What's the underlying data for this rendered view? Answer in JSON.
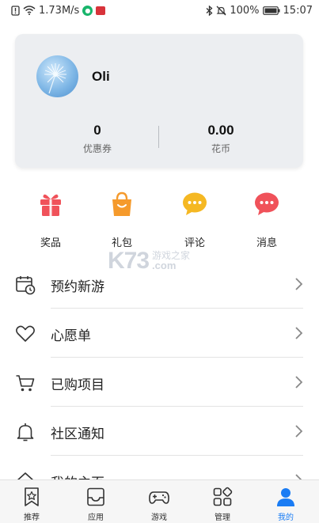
{
  "status_bar": {
    "speed": "1.73M/s",
    "battery": "100%",
    "time": "15:07"
  },
  "profile": {
    "username": "Oli",
    "stats": [
      {
        "value": "0",
        "label": "优惠券"
      },
      {
        "value": "0.00",
        "label": "花币"
      }
    ]
  },
  "quick_actions": [
    {
      "label": "奖品",
      "icon": "gift-icon",
      "color": "#f0525a"
    },
    {
      "label": "礼包",
      "icon": "bag-icon",
      "color": "#f59a2c"
    },
    {
      "label": "评论",
      "icon": "comment-icon",
      "color": "#f5b823"
    },
    {
      "label": "消息",
      "icon": "message-icon",
      "color": "#f0525a"
    }
  ],
  "watermark": {
    "logo": "K73",
    "line1": "游戏之家",
    "line2": ".com"
  },
  "menu": [
    {
      "label": "预约新游",
      "icon": "calendar-clock-icon"
    },
    {
      "label": "心愿单",
      "icon": "heart-icon"
    },
    {
      "label": "已购项目",
      "icon": "cart-icon"
    },
    {
      "label": "社区通知",
      "icon": "bell-icon"
    },
    {
      "label": "我的主页",
      "icon": "home-icon"
    }
  ],
  "bottom_nav": [
    {
      "label": "推荐",
      "icon": "star-bookmark-icon",
      "active": false
    },
    {
      "label": "应用",
      "icon": "app-box-icon",
      "active": false
    },
    {
      "label": "游戏",
      "icon": "gamepad-icon",
      "active": false
    },
    {
      "label": "管理",
      "icon": "grid-manage-icon",
      "active": false
    },
    {
      "label": "我的",
      "icon": "person-icon",
      "active": true
    }
  ],
  "colors": {
    "accent": "#1a7cf4",
    "card_bg": "#eceef1"
  }
}
